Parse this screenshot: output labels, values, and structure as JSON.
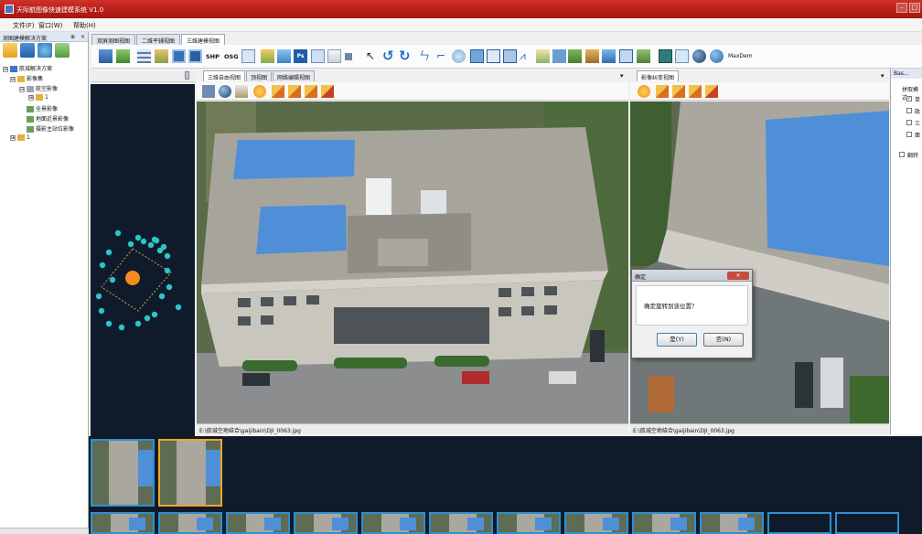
{
  "window": {
    "title": "天际航图像快速建模系统 V1.0"
  },
  "menu": [
    {
      "label": "文件(F)"
    },
    {
      "label": "窗口(W)"
    },
    {
      "label": "帮助(H)"
    }
  ],
  "left_panel": {
    "header": "测图建模解决方案",
    "pin": "⊕",
    "close": "×",
    "tree": [
      {
        "label": "航城解决方案",
        "toggle": "⊟"
      },
      {
        "label": "影像集",
        "toggle": "⊟"
      },
      {
        "label": "航空影像",
        "toggle": "⊟"
      },
      {
        "label": "1",
        "toggle": "⊞"
      },
      {
        "label": "全景影像",
        "toggle": ""
      },
      {
        "label": "地面近景影像",
        "toggle": ""
      },
      {
        "label": "摄影主站位影像",
        "toggle": ""
      },
      {
        "label": "1",
        "toggle": "⊞"
      }
    ]
  },
  "doc_tabs": [
    "双屏测图视图",
    "二维平辅视图",
    "三维建模视图"
  ],
  "toolbar": {
    "shp": "SHP",
    "osg": "OSG",
    "ps": "Ps",
    "maxdem": "MaxDem"
  },
  "view_left": {
    "tabs": [
      "三维自由视图",
      "顶视图",
      "网络编辑视图"
    ],
    "dropdown": "▾",
    "path": "E:\\航城空地结合\\gaijibain\\DJI_0063.jpg"
  },
  "view_right": {
    "tabs": [
      "影像纠变视图"
    ],
    "dropdown": "▾",
    "path": "E:\\航城空地结合\\gaijibain\\DJI_0063.jpg"
  },
  "right_panel": {
    "header": "Bas...",
    "label": "拼取模式",
    "options": [
      {
        "label": "单",
        "checked": true
      },
      {
        "label": "政",
        "checked": false
      },
      {
        "label": "三",
        "checked": false
      },
      {
        "label": "面",
        "checked": false
      }
    ],
    "flip": {
      "label": "翻转",
      "checked": false
    }
  },
  "dialog": {
    "title": "确定",
    "close": "✕",
    "message": "确定旋转到该位置？",
    "yes": "是(Y)",
    "no": "否(N)"
  },
  "colors": {
    "titlebar": "#b41e17",
    "dark_bg": "#0f1b2b",
    "camera_dot": "#2ec4c7",
    "center_dot": "#f28c1c",
    "selected_thumb": "#f5a623",
    "roof_blue": "#4e8fd8"
  }
}
